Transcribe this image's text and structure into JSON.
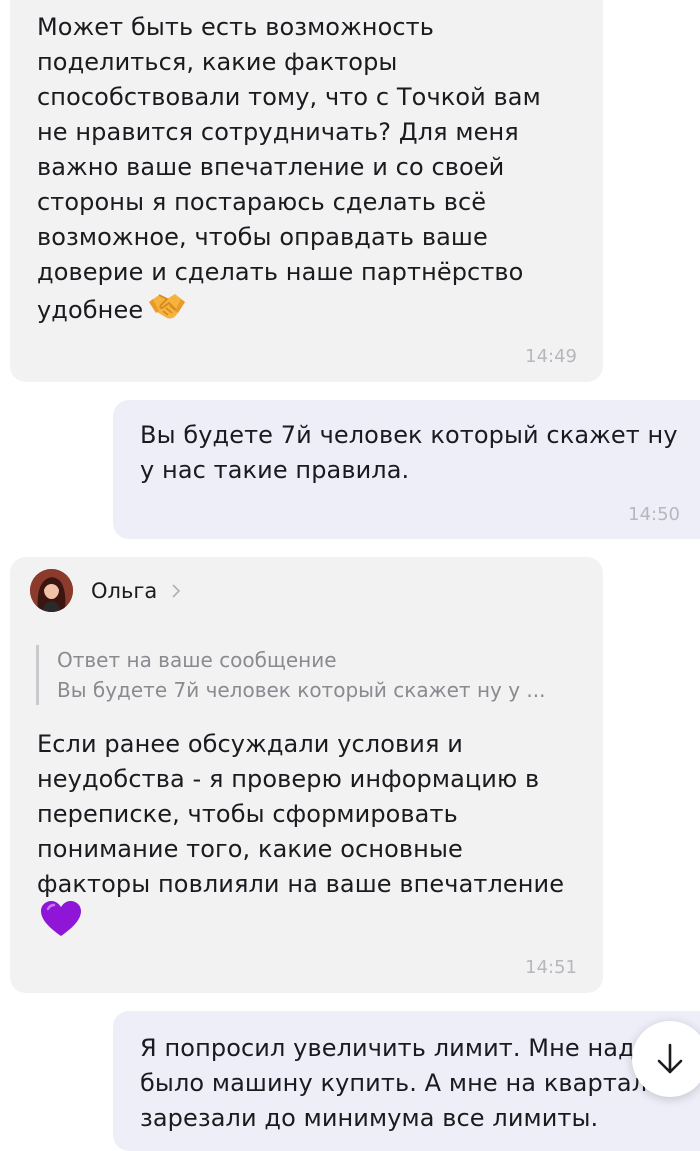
{
  "messages": [
    {
      "direction": "incoming",
      "text": "Может быть есть возможность\nподелиться, какие факторы\nспособствовали тому, что с Точкой вам\nне нравится сотрудничать? Для меня\nважно ваше впечатление и со своей\nстороны я постараюсь сделать всё\nвозможное, чтобы оправдать ваше\nдоверие и сделать наше партнёрство\nудобнее",
      "emoji": "handshake-emoji",
      "time": "14:49"
    },
    {
      "direction": "outgoing",
      "text": "Вы будете 7й человек который скажет ну\nу нас такие правила.",
      "time": "14:50"
    },
    {
      "direction": "incoming",
      "sender": "Ольга",
      "reply_to": {
        "title": "Ответ на ваше сообщение",
        "preview": "Вы будете 7й человек который скажет ну у ..."
      },
      "text": "Если ранее обсуждали условия и\nнеудобства - я проверю информацию в\nпереписке, чтобы сформировать\nпонимание того, какие основные\nфакторы повлияли на ваше впечатление",
      "emoji": "purple-heart-emoji",
      "time": "14:51"
    },
    {
      "direction": "outgoing",
      "text": "Я попросил увеличить лимит. Мне над\nбыло машину купить. А мне на квартал\nзарезали до минимума все лимиты."
    }
  ],
  "colors": {
    "incoming_bubble": "#f2f2f3",
    "outgoing_bubble": "#eeeef9",
    "timestamp": "#b7b7bd",
    "reply_bar": "#c9c9ce"
  },
  "icons": {
    "sender_chevron": "chevron-right-icon",
    "scroll_down": "arrow-down-icon"
  }
}
